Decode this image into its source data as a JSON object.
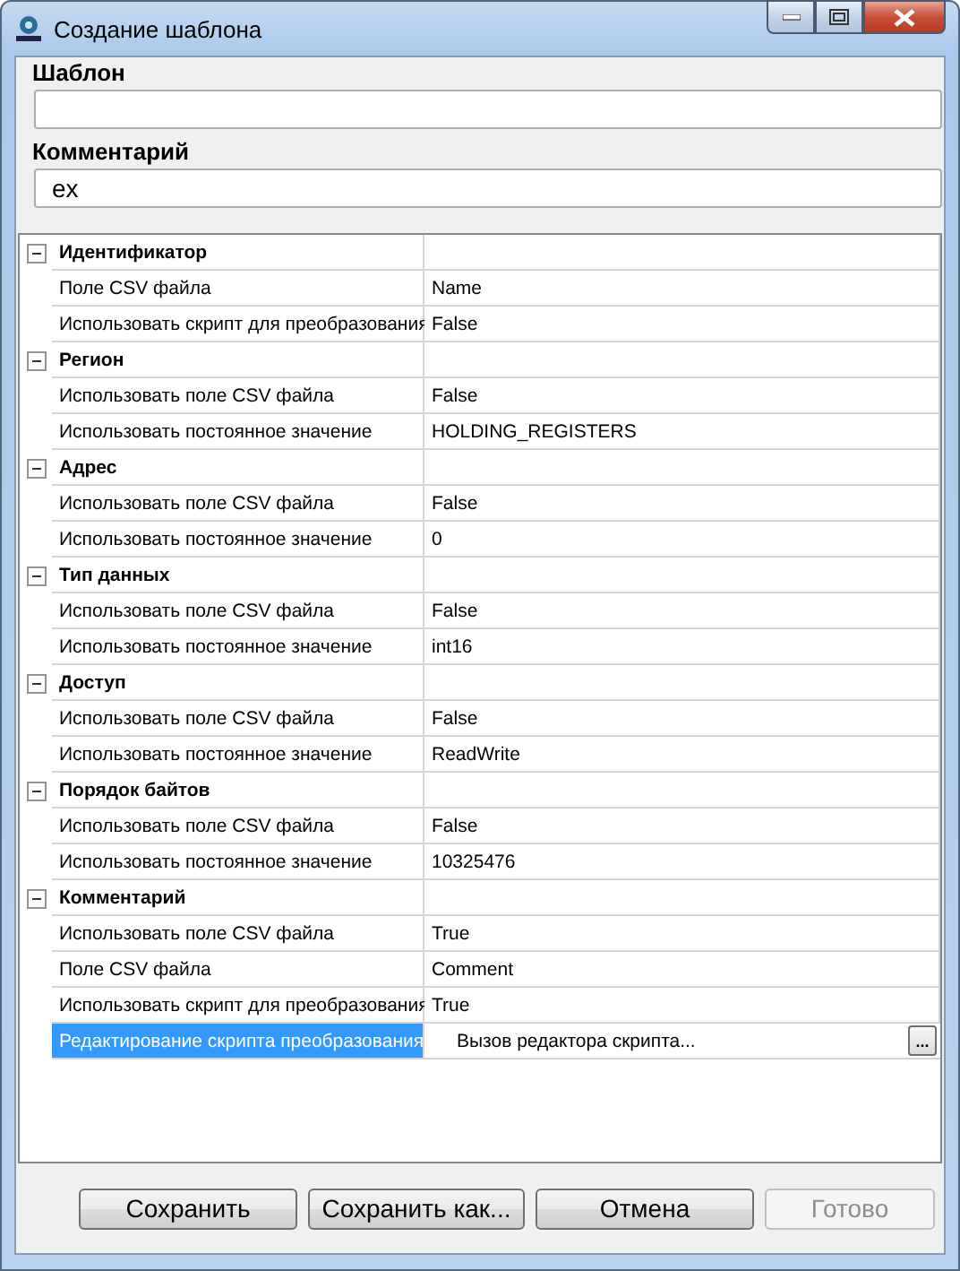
{
  "window": {
    "title": "Создание шаблона"
  },
  "fields": [
    {
      "label": "Шаблон"
    },
    {
      "label": "Комментарий",
      "value": "ex"
    }
  ],
  "groups": [
    {
      "title": "Идентификатор",
      "expanded": true,
      "rows": [
        {
          "name": "Поле CSV файла",
          "value": "Name",
          "selected": false,
          "kind": "text"
        },
        {
          "name": "Использовать скрипт для преобразования",
          "value": "False",
          "selected": false,
          "kind": "text"
        }
      ]
    },
    {
      "title": "Регион",
      "expanded": true,
      "rows": [
        {
          "name": "Использовать поле CSV файла",
          "value": "False",
          "selected": false,
          "kind": "text"
        },
        {
          "name": "Использовать постоянное значение",
          "value": "HOLDING_REGISTERS",
          "selected": false,
          "kind": "text"
        }
      ]
    },
    {
      "title": "Адрес",
      "expanded": true,
      "rows": [
        {
          "name": "Использовать поле CSV файла",
          "value": "False",
          "selected": false,
          "kind": "text"
        },
        {
          "name": "Использовать постоянное значение",
          "value": "0",
          "selected": false,
          "kind": "text"
        }
      ]
    },
    {
      "title": "Тип данных",
      "expanded": true,
      "rows": [
        {
          "name": "Использовать поле CSV файла",
          "value": "False",
          "selected": false,
          "kind": "text"
        },
        {
          "name": "Использовать постоянное значение",
          "value": "int16",
          "selected": false,
          "kind": "text"
        }
      ]
    },
    {
      "title": "Доступ",
      "expanded": true,
      "rows": [
        {
          "name": "Использовать поле CSV файла",
          "value": "False",
          "selected": false,
          "kind": "text"
        },
        {
          "name": "Использовать постоянное значение",
          "value": "ReadWrite",
          "selected": false,
          "kind": "text"
        }
      ]
    },
    {
      "title": "Порядок байтов",
      "expanded": true,
      "rows": [
        {
          "name": "Использовать поле CSV файла",
          "value": "False",
          "selected": false,
          "kind": "text"
        },
        {
          "name": "Использовать постоянное значение",
          "value": "10325476",
          "selected": false,
          "kind": "text"
        }
      ]
    },
    {
      "title": "Комментарий",
      "expanded": true,
      "rows": [
        {
          "name": "Использовать поле CSV файла",
          "value": "True",
          "selected": false,
          "kind": "text"
        },
        {
          "name": "Поле CSV файла",
          "value": "Comment",
          "selected": false,
          "kind": "text"
        },
        {
          "name": "Использовать скрипт для преобразования",
          "value": "True",
          "selected": false,
          "kind": "text"
        },
        {
          "name": "Редактирование скрипта преобразования",
          "value": "Вызов редактора скрипта...",
          "selected": true,
          "kind": "editor",
          "button_label": "..."
        }
      ]
    }
  ],
  "buttons": [
    {
      "label": "Сохранить",
      "disabled": false
    },
    {
      "label": "Сохранить как...",
      "disabled": false
    },
    {
      "label": "Отмена",
      "disabled": false
    },
    {
      "label": "Готово",
      "disabled": true
    }
  ]
}
